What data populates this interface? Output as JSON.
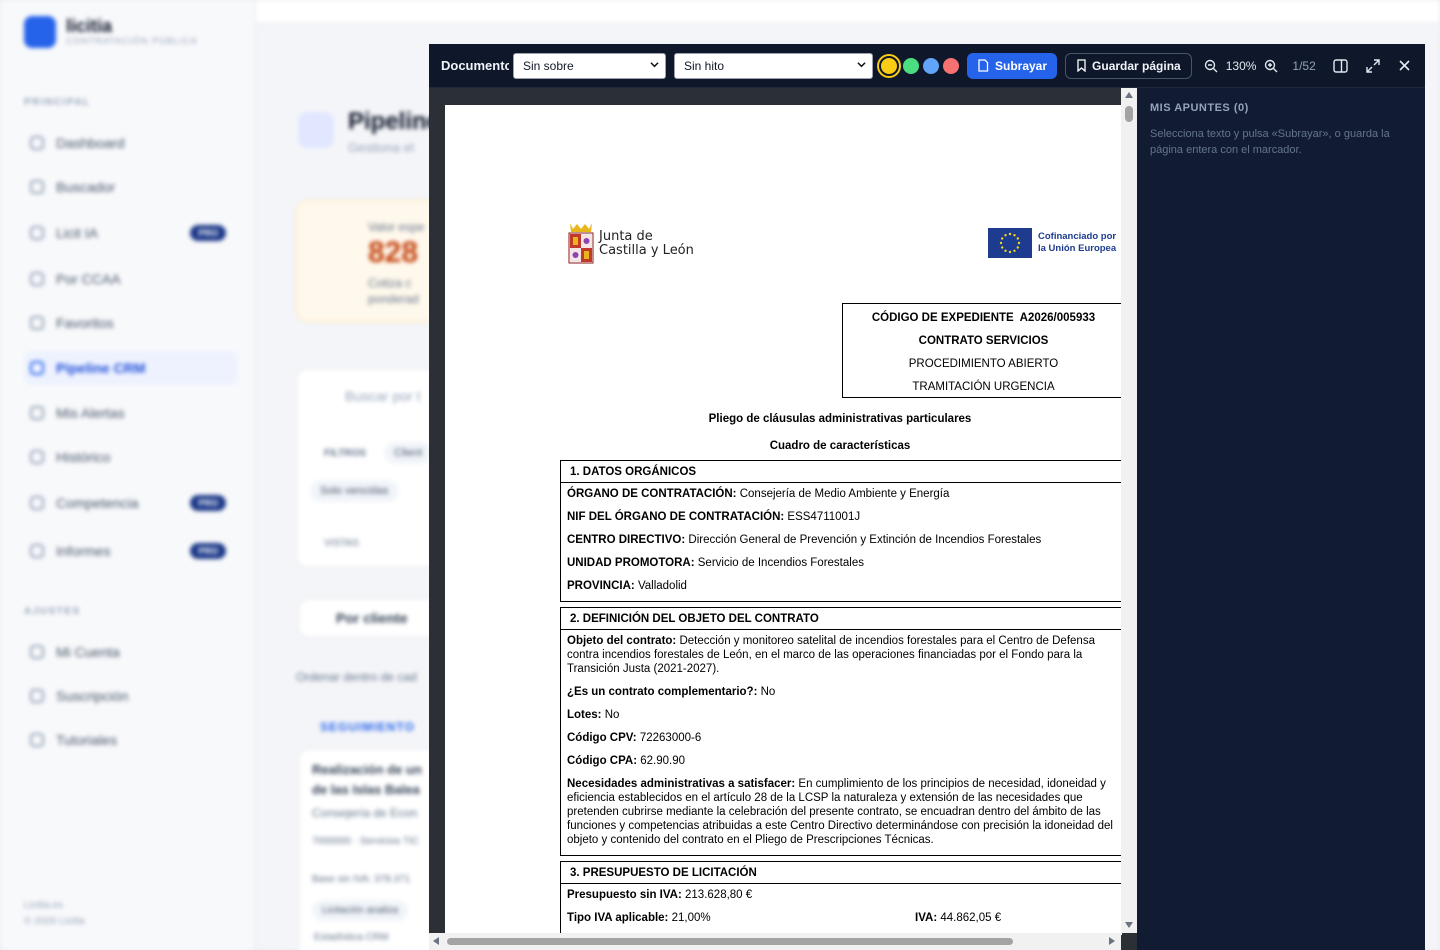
{
  "background": {
    "brand": {
      "name": "licitia",
      "tagline": "CONTRATACIÓN PÚBLICA"
    },
    "sections": {
      "principal": "PRINCIPAL",
      "ajustes": "AJUSTES"
    },
    "nav": [
      {
        "label": "Dashboard",
        "badge": ""
      },
      {
        "label": "Buscador",
        "badge": ""
      },
      {
        "label": "Licit IA",
        "badge": "PRO"
      },
      {
        "label": "Por CCAA",
        "badge": ""
      },
      {
        "label": "Favoritos",
        "badge": ""
      },
      {
        "label": "Pipeline CRM",
        "badge": ""
      },
      {
        "label": "Mis Alertas",
        "badge": ""
      },
      {
        "label": "Histórico",
        "badge": ""
      },
      {
        "label": "Competencia",
        "badge": "PRO"
      },
      {
        "label": "Informes",
        "badge": "PRO"
      }
    ],
    "settings_nav": [
      "Mi Cuenta",
      "Suscripción",
      "Tutoriales"
    ],
    "footer": [
      "Licitia.es",
      "© 2026 Licitia"
    ],
    "page_title": "Pipeline",
    "page_subtitle": "Gestiona el",
    "value_label": "Valor espe",
    "value": "828",
    "value_note_1": "Cotiza c",
    "value_note_2": "ponderad",
    "search_placeholder": "Buscar por t",
    "filters_label": "FILTROS",
    "filter_chip": "Client",
    "chip_vencidas": "Solo vencidas",
    "vistas": "VISTAS",
    "group_by": "Por cliente",
    "order_hint": "Ordenar dentro de cad",
    "section_seguimiento": "SEGUIMIENTO",
    "card_title": "Realización de un",
    "card_title_2": "de las Islas Balea",
    "card_org": "Consejería de Econ",
    "card_meta": "7000000 · Servicios TIC",
    "card_budget": "Base sin IVA: 378.371",
    "card_status": "Licitación analiza",
    "card_status_2": "Estadística CRM"
  },
  "viewer": {
    "title": "Documento",
    "sobre_select": "Sin sobre",
    "hito_select": "Sin hito",
    "colors": {
      "yellow": "#facc15",
      "green": "#4ade80",
      "blue": "#60a5fa",
      "red": "#f87171",
      "primary": "#2563eb"
    },
    "subrayar_label": "Subrayar",
    "guardar_label": "Guardar página",
    "zoom": "130%",
    "page": "1/52",
    "icons": [
      "zoom-out-icon",
      "zoom-in-icon",
      "sidebar-toggle-icon",
      "expand-icon",
      "close-icon"
    ]
  },
  "notes": {
    "title": "MIS APUNTES (0)",
    "hint": "Selecciona texto y pulsa «Subrayar», o guarda la página entera con el marcador."
  },
  "document": {
    "jcyl_line1": "Junta de",
    "jcyl_line2": "Castilla y León",
    "eu_line1": "Cofinanciado por",
    "eu_line2": "la Unión Europea",
    "code_label": "CÓDIGO DE EXPEDIENTE",
    "code_value": "A2026/005933",
    "contract_type": "CONTRATO  SERVICIOS",
    "procedure": "PROCEDIMIENTO ABIERTO",
    "processing": "TRAMITACIÓN  URGENCIA",
    "main_title": "Pliego de cláusulas administrativas particulares",
    "sub_title": "Cuadro de características",
    "s1_title": "1. DATOS ORGÁNICOS",
    "s1": [
      {
        "k": "ÓRGANO DE CONTRATACIÓN:",
        "v": "Consejería de Medio Ambiente y Energía"
      },
      {
        "k": "NIF DEL ÓRGANO DE CONTRATACIÓN:",
        "v": "ESS4711001J"
      },
      {
        "k": "CENTRO DIRECTIVO:",
        "v": "Dirección General de Prevención y Extinción de Incendios Forestales"
      },
      {
        "k": "UNIDAD PROMOTORA:",
        "v": "Servicio de Incendios Forestales"
      },
      {
        "k": "PROVINCIA:",
        "v": "Valladolid"
      }
    ],
    "s2_title": "2. DEFINICIÓN DEL OBJETO DEL CONTRATO",
    "s2": [
      {
        "k": "Objeto del contrato:",
        "v": "Detección y monitoreo satelital de incendios forestales para el Centro  de Defensa contra incendios forestales de León, en el marco de las  operaciones financiadas por el Fondo para la Transición Justa  (2021-2027)."
      },
      {
        "k": "¿Es un contrato complementario?:",
        "v": "No"
      },
      {
        "k": "Lotes:",
        "v": "No"
      },
      {
        "k": "Código CPV:",
        "v": "72263000-6"
      },
      {
        "k": "Código CPA:",
        "v": "62.90.90"
      },
      {
        "k": "Necesidades administrativas a satisfacer:",
        "v": "En cumplimiento de los principios de necesidad, idoneidad y eficiencia  establecidos en el artículo 28 de la LCSP la naturaleza y extensión de  las necesidades que pretenden cubrirse mediante la celebración del  presente contrato, se encuadran dentro del ámbito de las funciones y  competencias atribuidas a este Centro Directivo determinándose con  precisión la idoneidad del objeto y contenido del contrato en el Pliego  de Prescripciones Técnicas."
      }
    ],
    "s3_title": "3. PRESUPUESTO DE LICITACIÓN",
    "s3_presupuesto_k": "Presupuesto sin IVA:",
    "s3_presupuesto_v": "213.628,80 €",
    "s3_tipo_k": "Tipo IVA aplicable:",
    "s3_tipo_v": "21,00%",
    "s3_iva_k": "IVA:",
    "s3_iva_v": "44.862,05 €"
  }
}
